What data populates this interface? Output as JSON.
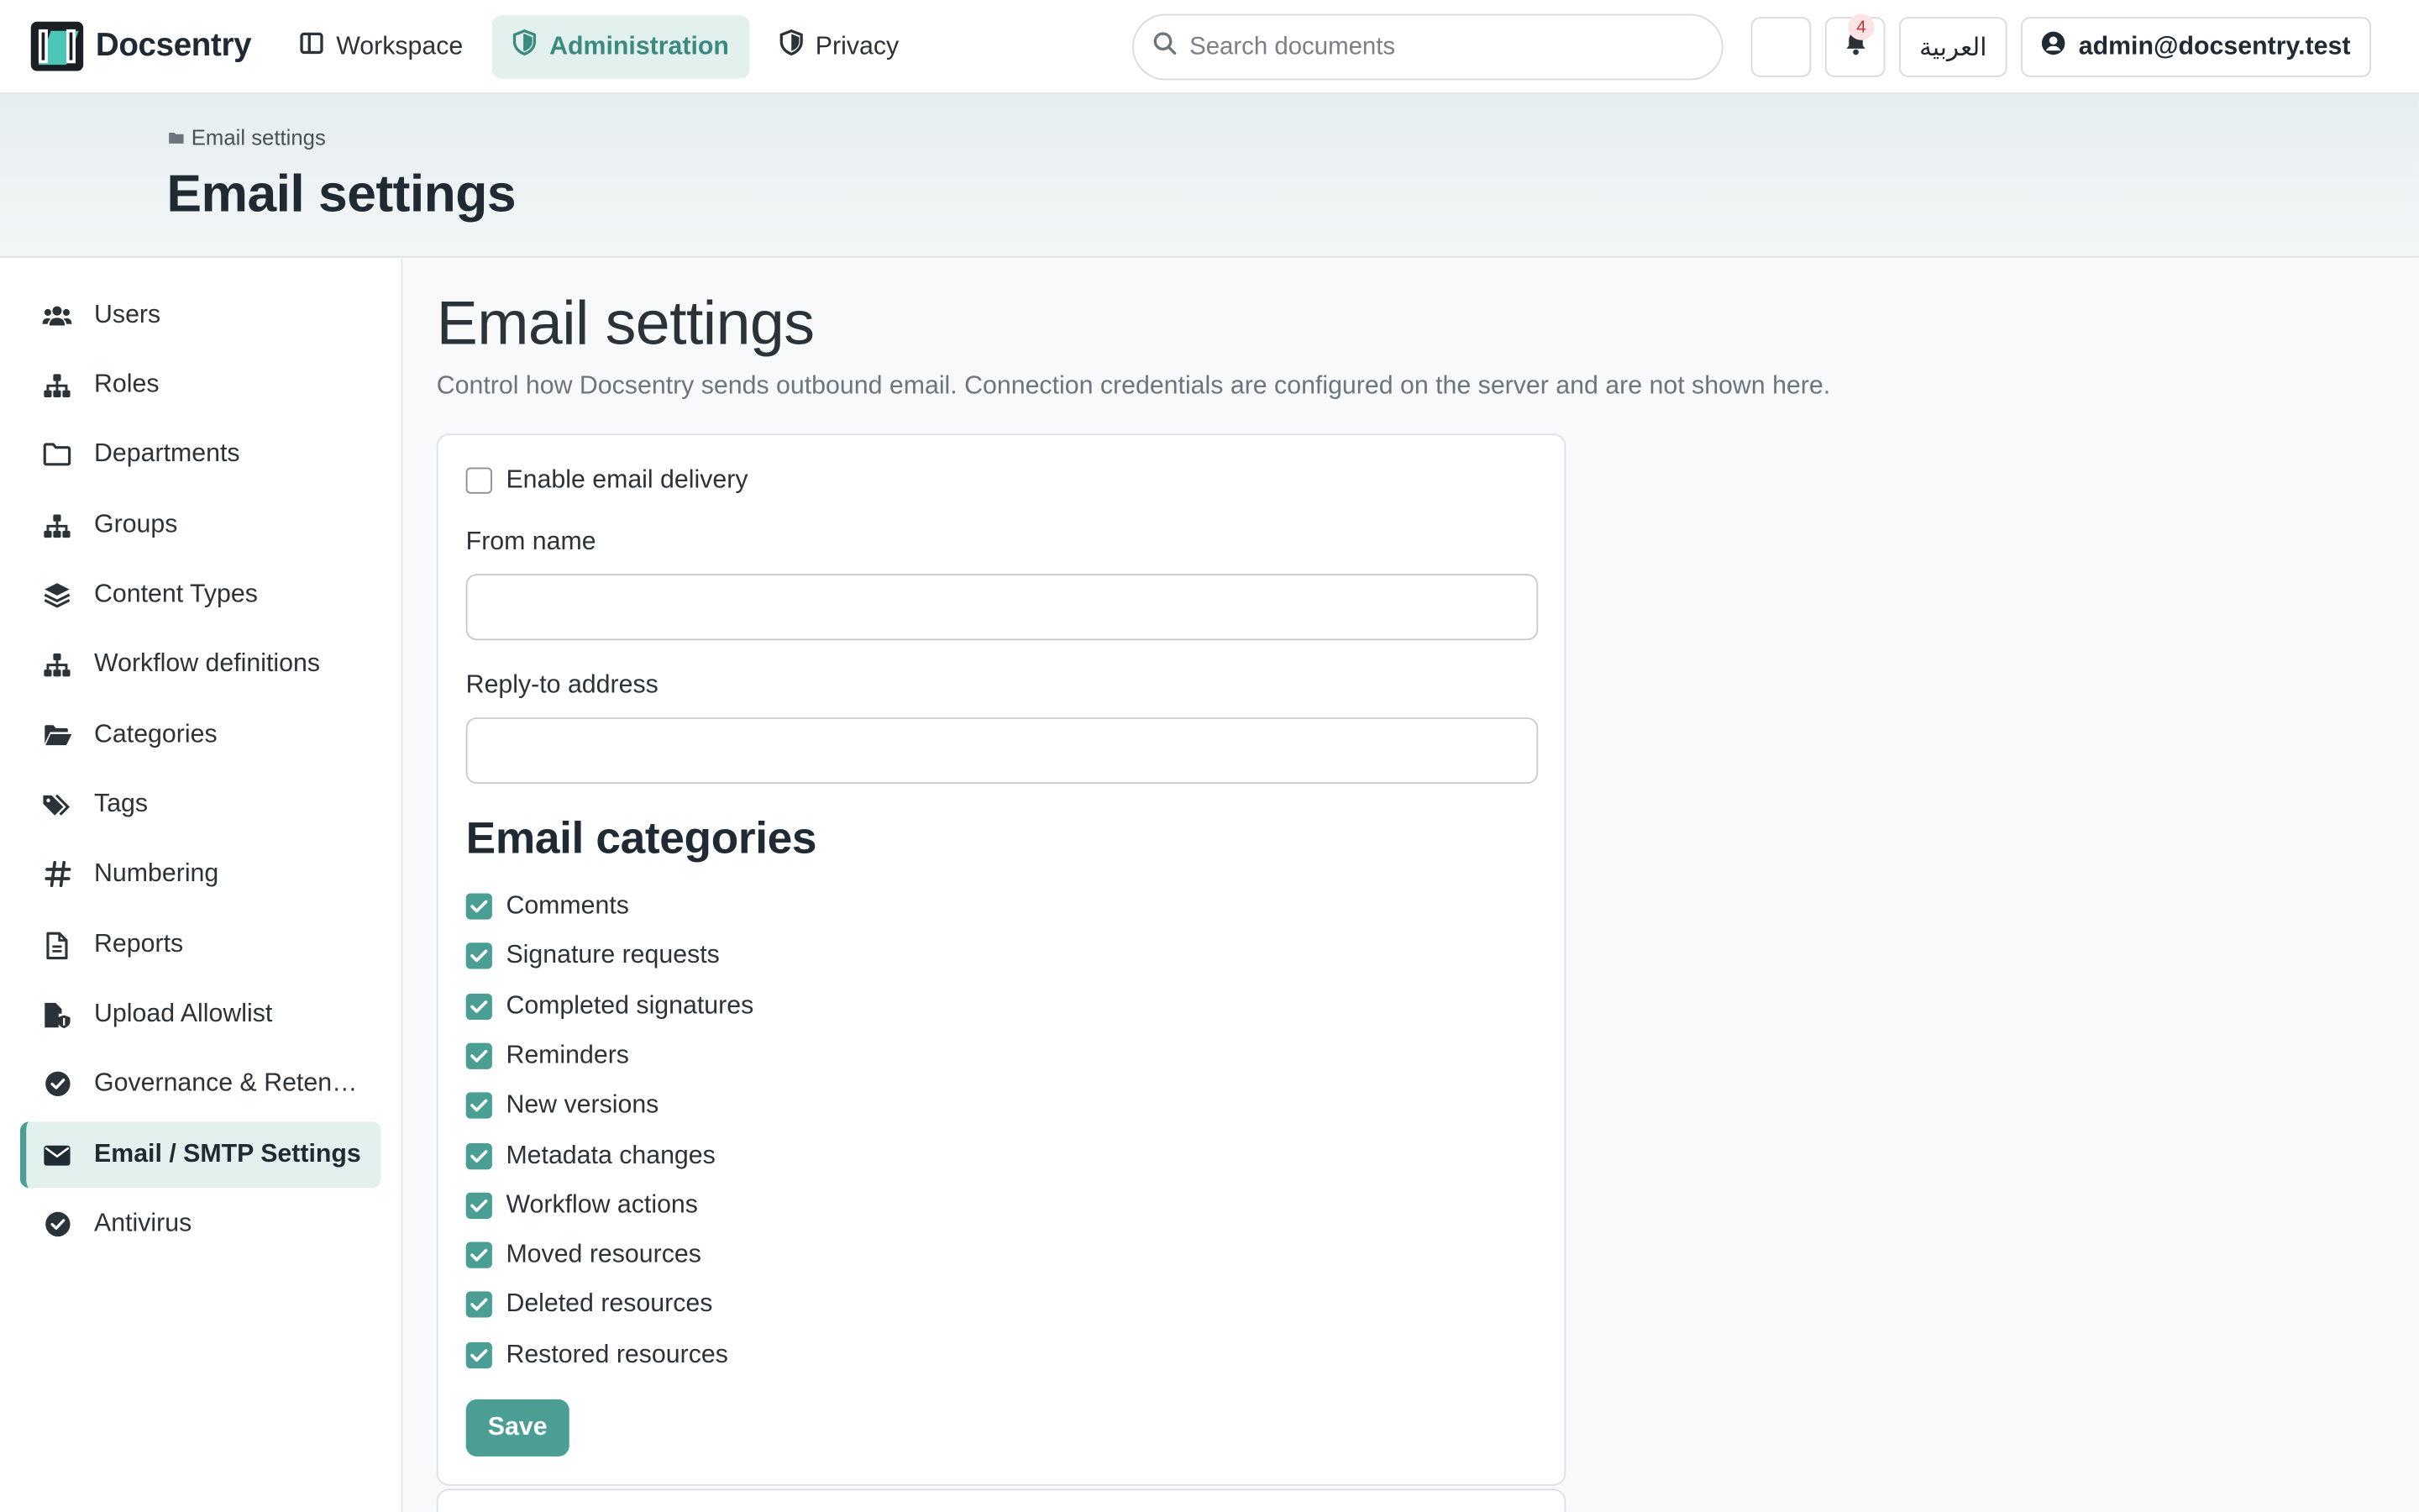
{
  "brand": {
    "name": "Docsentry"
  },
  "nav": {
    "links": [
      {
        "label": "Workspace",
        "icon": "layout-icon"
      },
      {
        "label": "Administration",
        "icon": "shield-icon",
        "active": true
      },
      {
        "label": "Privacy",
        "icon": "shield-half-icon"
      }
    ]
  },
  "search": {
    "placeholder": "Search documents",
    "value": ""
  },
  "topbar": {
    "theme_icon": "moon-icon",
    "notifications": {
      "icon": "bell-icon",
      "count": "4"
    },
    "language_label": "العربية",
    "account_label": "admin@docsentry.test"
  },
  "page": {
    "breadcrumb": "Email settings",
    "band_title": "Email settings",
    "title": "Email settings",
    "description": "Control how Docsentry sends outbound email. Connection credentials are configured on the server and are not shown here."
  },
  "sidebar": {
    "items": [
      {
        "label": "Users",
        "icon": "users-icon"
      },
      {
        "label": "Roles",
        "icon": "sitemap-icon"
      },
      {
        "label": "Departments",
        "icon": "folder-icon"
      },
      {
        "label": "Groups",
        "icon": "sitemap-icon"
      },
      {
        "label": "Content Types",
        "icon": "layers-icon"
      },
      {
        "label": "Workflow definitions",
        "icon": "sitemap-icon"
      },
      {
        "label": "Categories",
        "icon": "folder-open-icon"
      },
      {
        "label": "Tags",
        "icon": "tags-icon"
      },
      {
        "label": "Numbering",
        "icon": "hash-icon"
      },
      {
        "label": "Reports",
        "icon": "file-icon"
      },
      {
        "label": "Upload Allowlist",
        "icon": "file-shield-icon"
      },
      {
        "label": "Governance & Retention",
        "icon": "check-circle-icon"
      },
      {
        "label": "Email / SMTP Settings",
        "icon": "envelope-icon",
        "active": true
      },
      {
        "label": "Antivirus",
        "icon": "check-circle-icon"
      }
    ]
  },
  "form": {
    "enable_label": "Enable email delivery",
    "enable_checked": false,
    "from_name_label": "From name",
    "from_name_value": "",
    "reply_to_label": "Reply-to address",
    "reply_to_value": "",
    "categories_title": "Email categories",
    "categories": [
      {
        "label": "Comments",
        "checked": true
      },
      {
        "label": "Signature requests",
        "checked": true
      },
      {
        "label": "Completed signatures",
        "checked": true
      },
      {
        "label": "Reminders",
        "checked": true
      },
      {
        "label": "New versions",
        "checked": true
      },
      {
        "label": "Metadata changes",
        "checked": true
      },
      {
        "label": "Workflow actions",
        "checked": true
      },
      {
        "label": "Moved resources",
        "checked": true
      },
      {
        "label": "Deleted resources",
        "checked": true
      },
      {
        "label": "Restored resources",
        "checked": true
      }
    ],
    "save_label": "Save"
  },
  "colors": {
    "accent": "#4a9e93",
    "accent_soft": "#e3f1ee",
    "text": "#2b3339",
    "muted": "#6c757d"
  }
}
